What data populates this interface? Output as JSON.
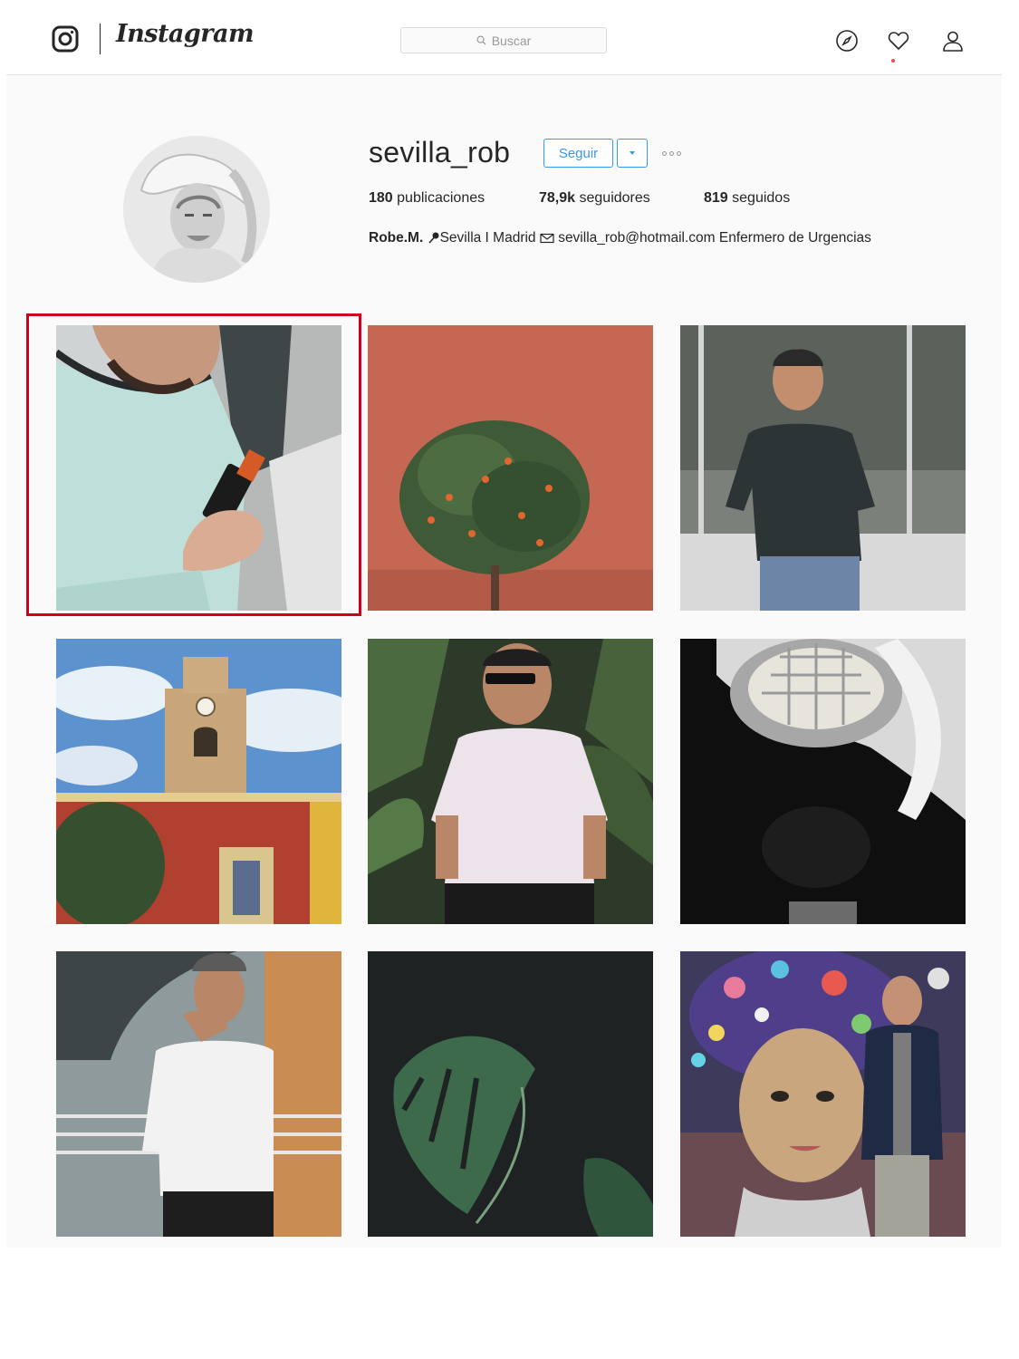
{
  "nav": {
    "wordmark": "Instagram",
    "search_placeholder": "Buscar",
    "icons": [
      "instagram-logo-icon",
      "explore-compass-icon",
      "activity-heart-icon",
      "profile-person-icon"
    ]
  },
  "profile": {
    "username": "sevilla_rob",
    "follow_label": "Seguir",
    "stats": {
      "posts_count": "180",
      "posts_label": "publicaciones",
      "followers_count": "78,9k",
      "followers_label": "seguidores",
      "following_count": "819",
      "following_label": "seguidos"
    },
    "bio": {
      "name": "Robe.M.",
      "location": "Sevilla I Madrid",
      "email": "sevilla_rob@hotmail.com",
      "text": "Enfermero de Urgencias"
    }
  },
  "colors": {
    "accent": "#3897f0",
    "highlight": "#d0021b",
    "notification": "#ed4956"
  },
  "posts": [
    {
      "subject": "man in mint t-shirt holding serum bottle",
      "highlighted": true
    },
    {
      "subject": "orange tree against red wall"
    },
    {
      "subject": "man in dark t-shirt in glass pavilion"
    },
    {
      "subject": "church clock tower"
    },
    {
      "subject": "man in sunglasses among plants"
    },
    {
      "subject": "spiral architecture structure"
    },
    {
      "subject": "man in white t-shirt by station"
    },
    {
      "subject": "monstera leaf on dark background"
    },
    {
      "subject": "man next to mosaic mural"
    }
  ]
}
